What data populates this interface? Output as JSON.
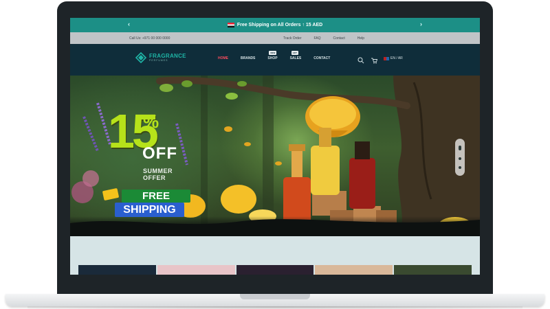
{
  "announcement": {
    "text": "Free Shipping on All Orders ↑ 15 AED",
    "prev_label": "‹",
    "next_label": "›"
  },
  "utility": {
    "phone": "Call Us: +971 00 000 0000",
    "links": [
      "Track Order",
      "FAQ",
      "Contact",
      "Help"
    ]
  },
  "header": {
    "logo_text": "FRAGRANCE",
    "logo_sub": "PERFUMES",
    "nav": [
      {
        "label": "HOME",
        "badge": ""
      },
      {
        "label": "BRANDS",
        "badge": ""
      },
      {
        "label": "SHOP",
        "badge": "NEW"
      },
      {
        "label": "SALES",
        "badge": "HOT"
      },
      {
        "label": "CONTACT",
        "badge": ""
      }
    ],
    "language": "EN / AR",
    "icons": [
      "search-icon",
      "cart-icon"
    ]
  },
  "hero": {
    "discount_number": "15",
    "discount_percent": "%",
    "discount_off": "OFF",
    "summer_line1": "SUMMER",
    "summer_line2": "OFFER",
    "free_label": "FREE",
    "shipping_label": "SHIPPING",
    "slides": 3,
    "active_slide": 1
  },
  "colors": {
    "announce_bg": "#1c8f86",
    "header_bg": "#0f2d3a",
    "nav_active": "#ff4d5e",
    "promo_green": "#b6e21a"
  }
}
